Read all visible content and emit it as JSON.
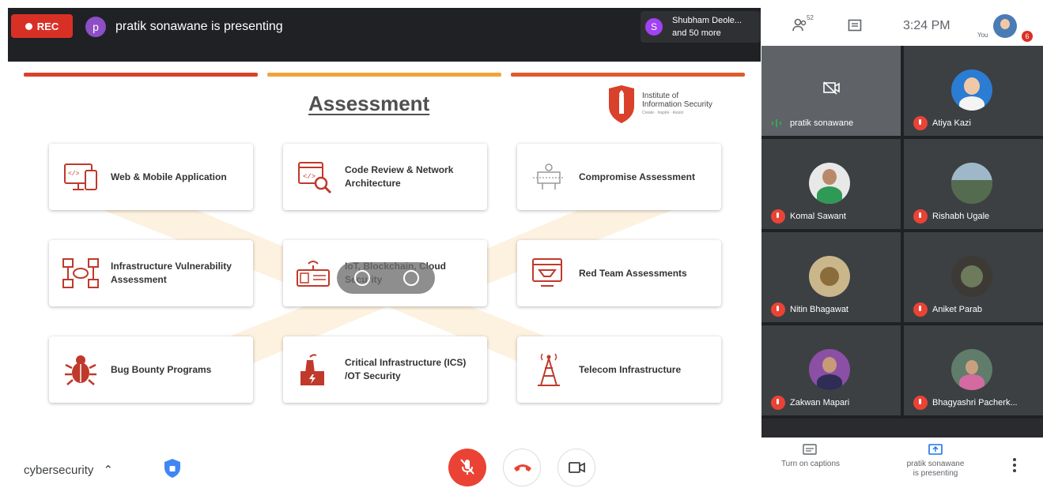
{
  "topbar": {
    "rec_label": "REC",
    "presenter_initial": "p",
    "presenter_text": "pratik sonawane is presenting",
    "others_initial": "S",
    "others_line1": "Shubham Deole...",
    "others_line2": "and 50 more",
    "people_count": "52",
    "time": "3:24 PM",
    "self_label": "You",
    "notification_count": "6"
  },
  "slide": {
    "title": "Assessment",
    "logo_line1": "Institute of",
    "logo_line2": "Information Security",
    "logo_tagline": "Create · Inspire · Assist",
    "cards": [
      {
        "label": "Web & Mobile Application",
        "icon": "web-mobile-icon"
      },
      {
        "label": "Code Review & Network Architecture",
        "icon": "code-review-icon"
      },
      {
        "label": "Compromise Assessment",
        "icon": "compromise-icon"
      },
      {
        "label": "Infrastructure Vulnerability Assessment",
        "icon": "infrastructure-icon"
      },
      {
        "label": "IoT, Blockchain, Cloud Security",
        "icon": "iot-icon"
      },
      {
        "label": "Red Team Assessments",
        "icon": "red-team-icon"
      },
      {
        "label": "Bug Bounty Programs",
        "icon": "bug-icon"
      },
      {
        "label": "Critical Infrastructure (ICS) /OT Security",
        "icon": "factory-icon"
      },
      {
        "label": "Telecom Infrastructure",
        "icon": "tower-icon"
      }
    ]
  },
  "participants": [
    {
      "name": "pratik sonawane",
      "presenting": true
    },
    {
      "name": "Atiya Kazi"
    },
    {
      "name": "Komal Sawant"
    },
    {
      "name": "Rishabh Ugale"
    },
    {
      "name": "Nitin Bhagawat"
    },
    {
      "name": "Aniket Parab"
    },
    {
      "name": "Zakwan Mapari"
    },
    {
      "name": "Bhagyashri Pacherk..."
    }
  ],
  "bottom": {
    "room_name": "cybersecurity",
    "captions_label": "Turn on captions",
    "presenting_line1": "pratik sonawane",
    "presenting_line2": "is presenting"
  },
  "colors": {
    "rec_red": "#d93025",
    "accent_red": "#d9412b",
    "accent_orange": "#f2a33a",
    "mute_red": "#ea4335"
  }
}
